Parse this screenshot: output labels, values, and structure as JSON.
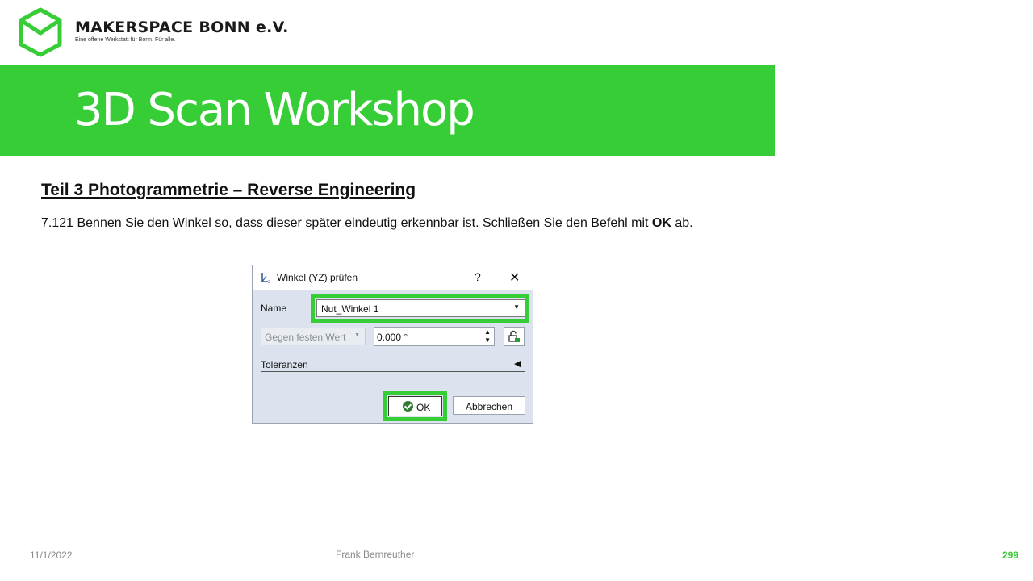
{
  "brand": {
    "name": "MAKERSPACE BONN e.V.",
    "tagline": "Eine offene Werkstatt für Bonn. Für alle.",
    "color": "#36cd36"
  },
  "banner": {
    "title": "3D Scan Workshop"
  },
  "section": {
    "title": "Teil 3  Photogrammetrie  – Reverse Engineering"
  },
  "instruction": {
    "text": "7.121 Bennen Sie den  Winkel so, dass dieser später eindeutig erkennbar ist. Schließen Sie den Befehl mit ",
    "emphasis": "OK",
    "suffix": " ab."
  },
  "dialog": {
    "title": "Winkel (YZ) prüfen",
    "help_label": "?",
    "close_label": "✕",
    "name_label": "Name",
    "name_value": "Nut_Winkel 1",
    "mode_value": "Gegen festen Wert",
    "value": "0.000 °",
    "tolerances_label": "Toleranzen",
    "ok_label": "OK",
    "cancel_label": "Abbrechen"
  },
  "footer": {
    "date": "11/1/2022",
    "author": "Frank Bernreuther",
    "page": "299"
  }
}
